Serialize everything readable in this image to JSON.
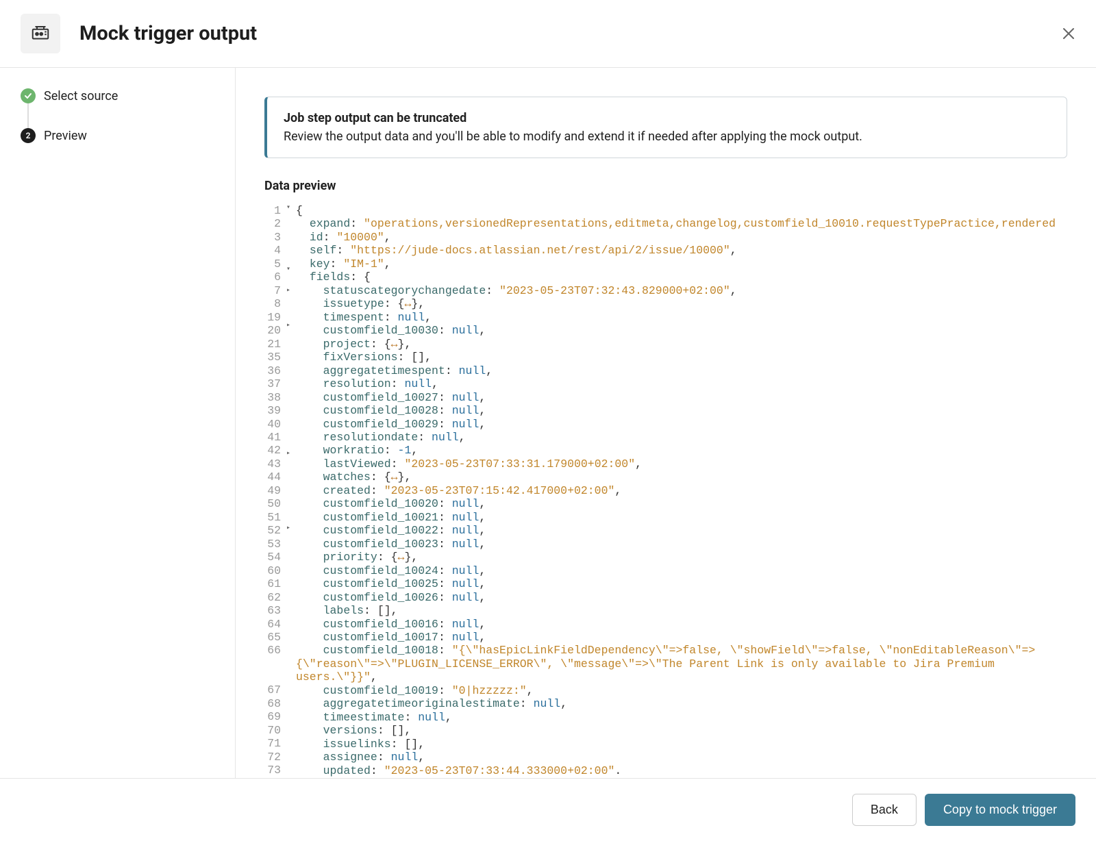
{
  "header": {
    "title": "Mock trigger output"
  },
  "sidebar": {
    "steps": [
      {
        "label": "Select source",
        "state": "done"
      },
      {
        "label": "Preview",
        "state": "active",
        "number": "2"
      }
    ]
  },
  "info": {
    "title": "Job step output can be truncated",
    "text": "Review the output data and you'll be able to modify and extend it if needed after applying the mock output."
  },
  "section_title": "Data preview",
  "footer": {
    "back": "Back",
    "primary": "Copy to mock trigger"
  },
  "code": {
    "lines": [
      {
        "num": "1",
        "fold": "down",
        "indent": 0,
        "tokens": [
          [
            "punc",
            "{"
          ]
        ]
      },
      {
        "num": "2",
        "indent": 1,
        "tokens": [
          [
            "key",
            "expand"
          ],
          [
            "punc",
            ": "
          ],
          [
            "str",
            "\"operations,versionedRepresentations,editmeta,changelog,customfield_10010.requestTypePractice,rendered"
          ]
        ]
      },
      {
        "num": "3",
        "indent": 1,
        "tokens": [
          [
            "key",
            "id"
          ],
          [
            "punc",
            ": "
          ],
          [
            "str",
            "\"10000\""
          ],
          [
            "punc",
            ","
          ]
        ]
      },
      {
        "num": "4",
        "indent": 1,
        "tokens": [
          [
            "key",
            "self"
          ],
          [
            "punc",
            ": "
          ],
          [
            "str",
            "\"https://jude-docs.atlassian.net/rest/api/2/issue/10000\""
          ],
          [
            "punc",
            ","
          ]
        ]
      },
      {
        "num": "5",
        "indent": 1,
        "tokens": [
          [
            "key",
            "key"
          ],
          [
            "punc",
            ": "
          ],
          [
            "str",
            "\"IM-1\""
          ],
          [
            "punc",
            ","
          ]
        ]
      },
      {
        "num": "6",
        "fold": "down",
        "indent": 1,
        "tokens": [
          [
            "key",
            "fields"
          ],
          [
            "punc",
            ": {"
          ]
        ]
      },
      {
        "num": "7",
        "indent": 2,
        "tokens": [
          [
            "key",
            "statuscategorychangedate"
          ],
          [
            "punc",
            ": "
          ],
          [
            "str",
            "\"2023-05-23T07:32:43.829000+02:00\""
          ],
          [
            "punc",
            ","
          ]
        ]
      },
      {
        "num": "8",
        "fold": "right",
        "indent": 2,
        "tokens": [
          [
            "key",
            "issuetype"
          ],
          [
            "punc",
            ": {"
          ],
          [
            "arrow",
            "↔"
          ],
          [
            "punc",
            "},"
          ]
        ]
      },
      {
        "num": "19",
        "indent": 2,
        "tokens": [
          [
            "key",
            "timespent"
          ],
          [
            "punc",
            ": "
          ],
          [
            "nullnum",
            "null"
          ],
          [
            "punc",
            ","
          ]
        ]
      },
      {
        "num": "20",
        "indent": 2,
        "tokens": [
          [
            "key",
            "customfield_10030"
          ],
          [
            "punc",
            ": "
          ],
          [
            "nullnum",
            "null"
          ],
          [
            "punc",
            ","
          ]
        ]
      },
      {
        "num": "21",
        "fold": "right",
        "indent": 2,
        "tokens": [
          [
            "key",
            "project"
          ],
          [
            "punc",
            ": {"
          ],
          [
            "arrow",
            "↔"
          ],
          [
            "punc",
            "},"
          ]
        ]
      },
      {
        "num": "35",
        "indent": 2,
        "tokens": [
          [
            "key",
            "fixVersions"
          ],
          [
            "punc",
            ": [],"
          ]
        ]
      },
      {
        "num": "36",
        "indent": 2,
        "tokens": [
          [
            "key",
            "aggregatetimespent"
          ],
          [
            "punc",
            ": "
          ],
          [
            "nullnum",
            "null"
          ],
          [
            "punc",
            ","
          ]
        ]
      },
      {
        "num": "37",
        "indent": 2,
        "tokens": [
          [
            "key",
            "resolution"
          ],
          [
            "punc",
            ": "
          ],
          [
            "nullnum",
            "null"
          ],
          [
            "punc",
            ","
          ]
        ]
      },
      {
        "num": "38",
        "indent": 2,
        "tokens": [
          [
            "key",
            "customfield_10027"
          ],
          [
            "punc",
            ": "
          ],
          [
            "nullnum",
            "null"
          ],
          [
            "punc",
            ","
          ]
        ]
      },
      {
        "num": "39",
        "indent": 2,
        "tokens": [
          [
            "key",
            "customfield_10028"
          ],
          [
            "punc",
            ": "
          ],
          [
            "nullnum",
            "null"
          ],
          [
            "punc",
            ","
          ]
        ]
      },
      {
        "num": "40",
        "indent": 2,
        "tokens": [
          [
            "key",
            "customfield_10029"
          ],
          [
            "punc",
            ": "
          ],
          [
            "nullnum",
            "null"
          ],
          [
            "punc",
            ","
          ]
        ]
      },
      {
        "num": "41",
        "indent": 2,
        "tokens": [
          [
            "key",
            "resolutiondate"
          ],
          [
            "punc",
            ": "
          ],
          [
            "nullnum",
            "null"
          ],
          [
            "punc",
            ","
          ]
        ]
      },
      {
        "num": "42",
        "indent": 2,
        "tokens": [
          [
            "key",
            "workratio"
          ],
          [
            "punc",
            ": "
          ],
          [
            "nullnum",
            "-1"
          ],
          [
            "punc",
            ","
          ]
        ]
      },
      {
        "num": "43",
        "indent": 2,
        "tokens": [
          [
            "key",
            "lastViewed"
          ],
          [
            "punc",
            ": "
          ],
          [
            "str",
            "\"2023-05-23T07:33:31.179000+02:00\""
          ],
          [
            "punc",
            ","
          ]
        ]
      },
      {
        "num": "44",
        "fold": "right",
        "indent": 2,
        "tokens": [
          [
            "key",
            "watches"
          ],
          [
            "punc",
            ": {"
          ],
          [
            "arrow",
            "↔"
          ],
          [
            "punc",
            "},"
          ]
        ]
      },
      {
        "num": "49",
        "indent": 2,
        "tokens": [
          [
            "key",
            "created"
          ],
          [
            "punc",
            ": "
          ],
          [
            "str",
            "\"2023-05-23T07:15:42.417000+02:00\""
          ],
          [
            "punc",
            ","
          ]
        ]
      },
      {
        "num": "50",
        "indent": 2,
        "tokens": [
          [
            "key",
            "customfield_10020"
          ],
          [
            "punc",
            ": "
          ],
          [
            "nullnum",
            "null"
          ],
          [
            "punc",
            ","
          ]
        ]
      },
      {
        "num": "51",
        "indent": 2,
        "tokens": [
          [
            "key",
            "customfield_10021"
          ],
          [
            "punc",
            ": "
          ],
          [
            "nullnum",
            "null"
          ],
          [
            "punc",
            ","
          ]
        ]
      },
      {
        "num": "52",
        "indent": 2,
        "tokens": [
          [
            "key",
            "customfield_10022"
          ],
          [
            "punc",
            ": "
          ],
          [
            "nullnum",
            "null"
          ],
          [
            "punc",
            ","
          ]
        ]
      },
      {
        "num": "53",
        "indent": 2,
        "tokens": [
          [
            "key",
            "customfield_10023"
          ],
          [
            "punc",
            ": "
          ],
          [
            "nullnum",
            "null"
          ],
          [
            "punc",
            ","
          ]
        ]
      },
      {
        "num": "54",
        "fold": "right",
        "indent": 2,
        "tokens": [
          [
            "key",
            "priority"
          ],
          [
            "punc",
            ": {"
          ],
          [
            "arrow",
            "↔"
          ],
          [
            "punc",
            "},"
          ]
        ]
      },
      {
        "num": "60",
        "indent": 2,
        "tokens": [
          [
            "key",
            "customfield_10024"
          ],
          [
            "punc",
            ": "
          ],
          [
            "nullnum",
            "null"
          ],
          [
            "punc",
            ","
          ]
        ]
      },
      {
        "num": "61",
        "indent": 2,
        "tokens": [
          [
            "key",
            "customfield_10025"
          ],
          [
            "punc",
            ": "
          ],
          [
            "nullnum",
            "null"
          ],
          [
            "punc",
            ","
          ]
        ]
      },
      {
        "num": "62",
        "indent": 2,
        "tokens": [
          [
            "key",
            "customfield_10026"
          ],
          [
            "punc",
            ": "
          ],
          [
            "nullnum",
            "null"
          ],
          [
            "punc",
            ","
          ]
        ]
      },
      {
        "num": "63",
        "indent": 2,
        "tokens": [
          [
            "key",
            "labels"
          ],
          [
            "punc",
            ": [],"
          ]
        ]
      },
      {
        "num": "64",
        "indent": 2,
        "tokens": [
          [
            "key",
            "customfield_10016"
          ],
          [
            "punc",
            ": "
          ],
          [
            "nullnum",
            "null"
          ],
          [
            "punc",
            ","
          ]
        ]
      },
      {
        "num": "65",
        "indent": 2,
        "tokens": [
          [
            "key",
            "customfield_10017"
          ],
          [
            "punc",
            ": "
          ],
          [
            "nullnum",
            "null"
          ],
          [
            "punc",
            ","
          ]
        ]
      },
      {
        "num": "66",
        "indent": 2,
        "wrap": true,
        "tokens": [
          [
            "key",
            "customfield_10018"
          ],
          [
            "punc",
            ": "
          ],
          [
            "str",
            "\"{\\\"hasEpicLinkFieldDependency\\\"=>false, \\\"showField\\\"=>false, \\\"nonEditableReason\\\"=>{\\\"reason\\\"=>\\\"PLUGIN_LICENSE_ERROR\\\", \\\"message\\\"=>\\\"The Parent Link is only available to Jira Premium users.\\\"}}\""
          ],
          [
            "punc",
            ","
          ]
        ]
      },
      {
        "num": "67",
        "indent": 2,
        "tokens": [
          [
            "key",
            "customfield_10019"
          ],
          [
            "punc",
            ": "
          ],
          [
            "str",
            "\"0|hzzzzz:\""
          ],
          [
            "punc",
            ","
          ]
        ]
      },
      {
        "num": "68",
        "indent": 2,
        "tokens": [
          [
            "key",
            "aggregatetimeoriginalestimate"
          ],
          [
            "punc",
            ": "
          ],
          [
            "nullnum",
            "null"
          ],
          [
            "punc",
            ","
          ]
        ]
      },
      {
        "num": "69",
        "indent": 2,
        "tokens": [
          [
            "key",
            "timeestimate"
          ],
          [
            "punc",
            ": "
          ],
          [
            "nullnum",
            "null"
          ],
          [
            "punc",
            ","
          ]
        ]
      },
      {
        "num": "70",
        "indent": 2,
        "tokens": [
          [
            "key",
            "versions"
          ],
          [
            "punc",
            ": [],"
          ]
        ]
      },
      {
        "num": "71",
        "indent": 2,
        "tokens": [
          [
            "key",
            "issuelinks"
          ],
          [
            "punc",
            ": [],"
          ]
        ]
      },
      {
        "num": "72",
        "indent": 2,
        "tokens": [
          [
            "key",
            "assignee"
          ],
          [
            "punc",
            ": "
          ],
          [
            "nullnum",
            "null"
          ],
          [
            "punc",
            ","
          ]
        ]
      },
      {
        "num": "73",
        "indent": 2,
        "tokens": [
          [
            "key",
            "updated"
          ],
          [
            "punc",
            ": "
          ],
          [
            "str",
            "\"2023-05-23T07:33:44.333000+02:00\""
          ],
          [
            "punc",
            "."
          ]
        ]
      }
    ]
  }
}
